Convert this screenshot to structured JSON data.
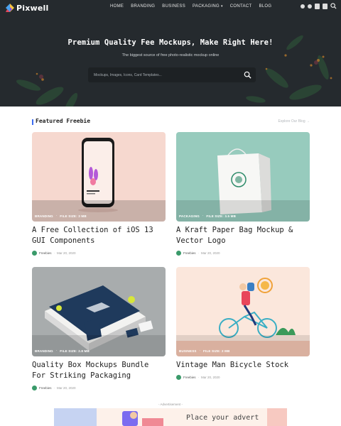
{
  "brand": {
    "name": "Pixwell"
  },
  "nav": {
    "items": [
      {
        "label": "HOME"
      },
      {
        "label": "BRANDING"
      },
      {
        "label": "BUSINESS"
      },
      {
        "label": "PACKAGING"
      },
      {
        "label": "CONTACT"
      },
      {
        "label": "BLOG"
      }
    ]
  },
  "hero": {
    "title": "Premium Quality Fee Mockups, Make Right Here!",
    "subtitle": "The biggest source of free photo-realistic mockup online",
    "search_placeholder": "Mockups, Images, Icons, Card Templates..."
  },
  "section": {
    "title": "Featured Freebie",
    "explore": "Explore Our Blog →"
  },
  "cards": [
    {
      "category": "BRANDING",
      "filesize": "FILE SIZE: 3 MB",
      "title": "A Free Collection of iOS 13 GUI Components",
      "author": "Freebies",
      "date": "Mar 20, 2020"
    },
    {
      "category": "PACKAGING",
      "filesize": "FILE SIZE: 3.5 MB",
      "title": "A Kraft Paper Bag Mockup & Vector Logo",
      "author": "Freebies",
      "date": "Mar 20, 2020"
    },
    {
      "category": "BRANDING",
      "filesize": "FILE SIZE: 2.8 MB",
      "title": "Quality Box Mockups Bundle For Striking Packaging",
      "author": "Freebies",
      "date": "Mar 20, 2020"
    },
    {
      "category": "BUSINESS",
      "filesize": "FILE SIZE: 2 MB",
      "title": "Vintage Man Bicycle Stock",
      "author": "Freebies",
      "date": "Mar 20, 2020"
    }
  ],
  "ad": {
    "label": "- Advertisement -",
    "text": "Place your advert"
  },
  "colors": {
    "accent": "#3d6cf0",
    "hero_bg": "#252a2e"
  }
}
